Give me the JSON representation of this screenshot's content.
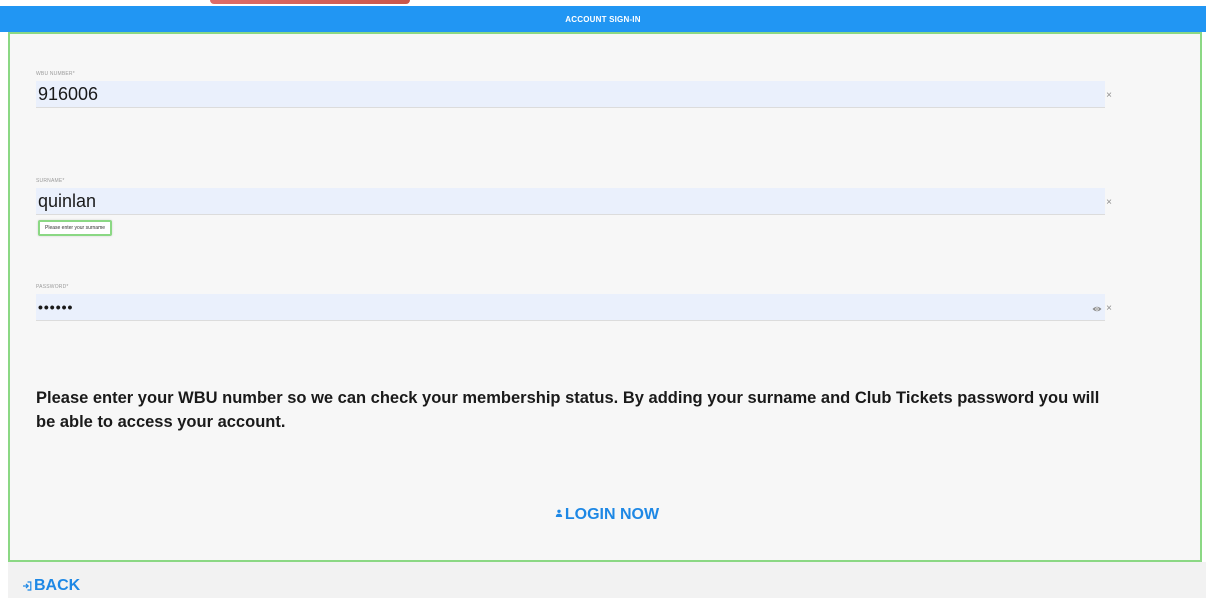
{
  "header": {
    "title": "ACCOUNT SIGN-IN"
  },
  "form": {
    "wbu": {
      "label": "WBU NUMBER*",
      "value": "916006",
      "clear_icon": "×"
    },
    "surname": {
      "label": "SURNAME*",
      "value": "quinlan",
      "clear_icon": "×",
      "tooltip": "Please enter your surname"
    },
    "password": {
      "label": "PASSWORD*",
      "masked_value": "••••••",
      "clear_icon": "×"
    }
  },
  "info_text": "Please enter your WBU number so we can check your membership status. By adding your surname and Club Tickets password you will be able to access your account.",
  "login_button": {
    "label": "LOGIN NOW",
    "icon": "user-icon"
  },
  "back_button": {
    "label": "BACK",
    "icon": "sign-in-icon"
  },
  "colors": {
    "header_bg": "#2196f3",
    "accent_green": "#8bd884",
    "link_blue": "#1e88e5",
    "input_bg": "#eaf0fc"
  }
}
